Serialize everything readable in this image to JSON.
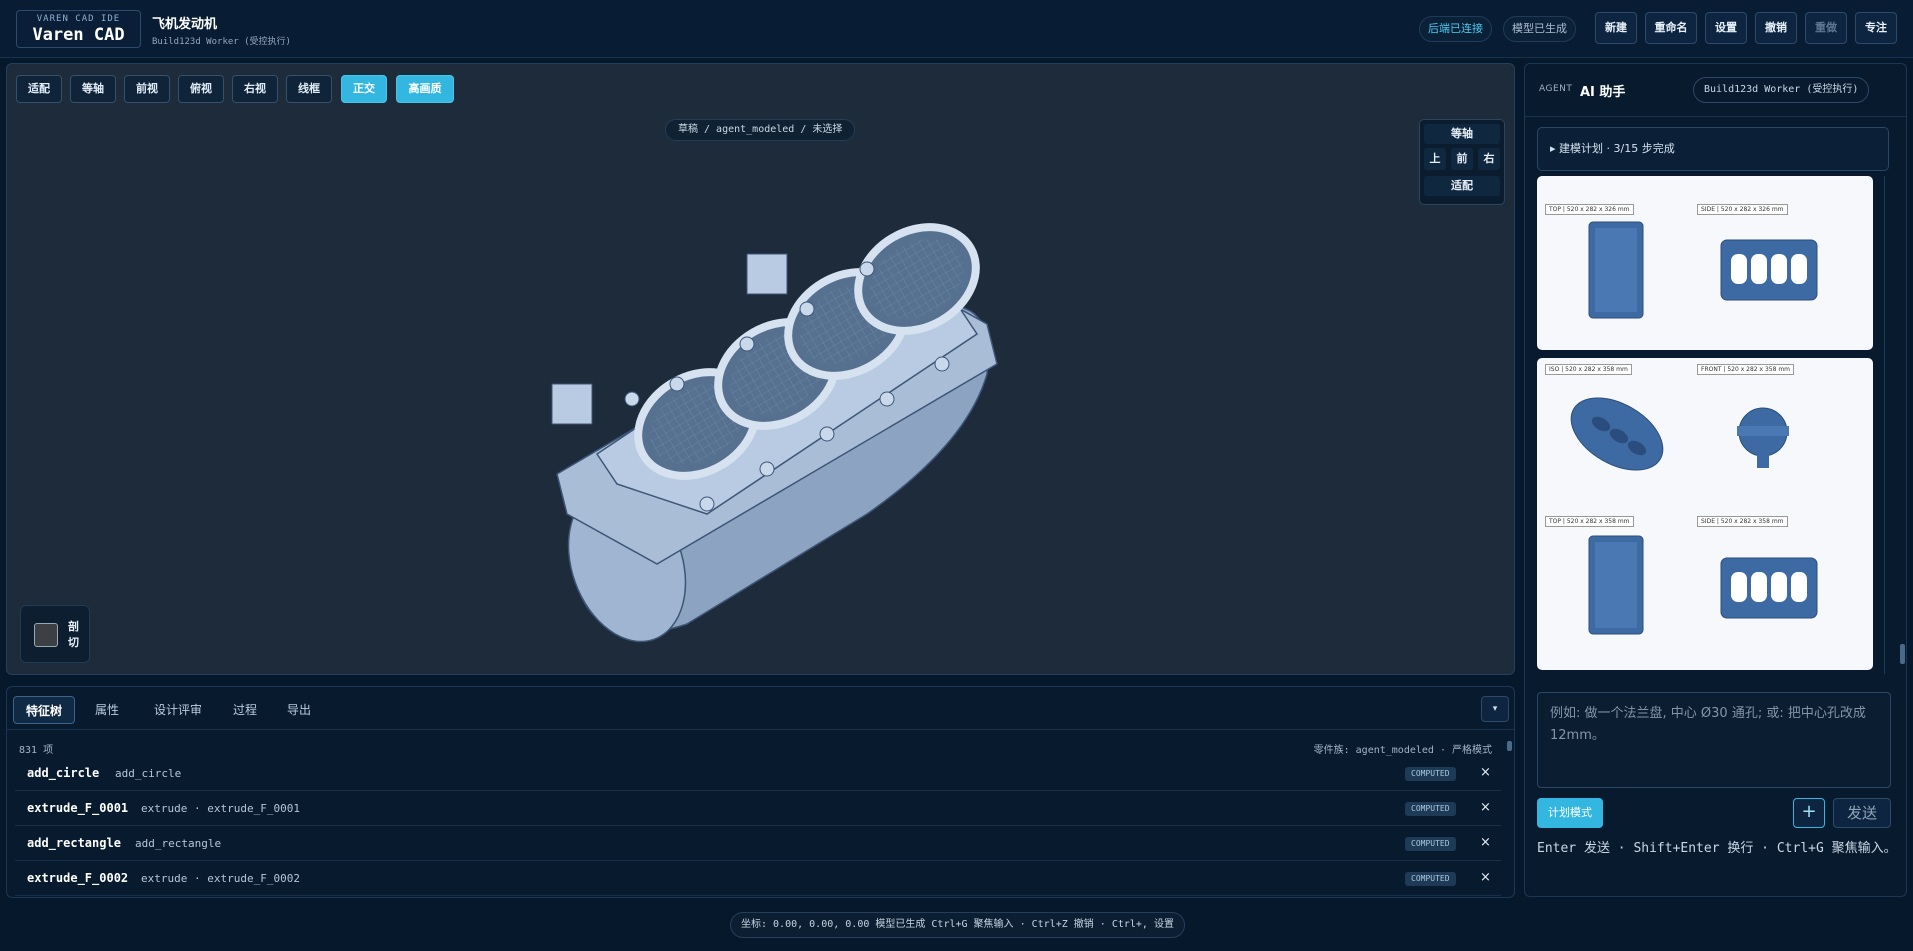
{
  "header": {
    "logo_small": "VAREN CAD IDE",
    "logo_big": "Varen CAD",
    "project_title": "飞机发动机",
    "project_sub": "Build123d Worker (受控执行)",
    "status_backend": "后端已连接",
    "status_model": "模型已生成",
    "buttons": {
      "new": "新建",
      "rename": "重命名",
      "settings": "设置",
      "undo": "撤销",
      "redo": "重做",
      "focus": "专注"
    }
  },
  "viewport": {
    "toolbar": {
      "fit": "适配",
      "iso": "等轴",
      "front": "前视",
      "top": "俯视",
      "right": "右视",
      "wire": "线框",
      "ortho": "正交",
      "hq": "高画质"
    },
    "breadcrumb": "草稿 / agent_modeled / 未选择",
    "viewcube": {
      "iso": "等轴",
      "top": "上",
      "front": "前",
      "right": "右",
      "fit": "适配"
    },
    "section_label": "剖切"
  },
  "bottom": {
    "tabs": {
      "features": "特征树",
      "props": "属性",
      "review": "设计评审",
      "process": "过程",
      "export": "导出"
    },
    "collapse": "▾",
    "count": "831 项",
    "family": "零件族: agent_modeled · 严格模式",
    "features": [
      {
        "name": "add_circle",
        "desc": "add_circle",
        "status": "COMPUTED",
        "del": "×"
      },
      {
        "name": "extrude_F_0001",
        "desc": "extrude · extrude_F_0001",
        "status": "COMPUTED",
        "del": "×"
      },
      {
        "name": "add_rectangle",
        "desc": "add_rectangle",
        "status": "COMPUTED",
        "del": "×"
      },
      {
        "name": "extrude_F_0002",
        "desc": "extrude · extrude_F_0002",
        "status": "COMPUTED",
        "del": "×"
      }
    ]
  },
  "statusbar": "坐标: 0.00, 0.00, 0.00   模型已生成   Ctrl+G 聚焦输入 · Ctrl+Z 撤销 · Ctrl+, 设置",
  "agent": {
    "tag": "AGENT",
    "title": "AI 助手",
    "worker": "Build123d Worker (受控执行)",
    "plan": "▸ 建模计划 · 3/15 步完成",
    "card1": {
      "top_label": "TOP | 520 x 282 x 326 mm",
      "side_label": "SIDE | 520 x 282 x 326 mm"
    },
    "card2": {
      "iso_label": "ISO | 520 x 282 x 358 mm",
      "front_label": "FRONT | 520 x 282 x 358 mm",
      "top_label": "TOP | 520 x 282 x 358 mm",
      "side_label": "SIDE | 520 x 282 x 358 mm"
    },
    "placeholder": "例如: 做一个法兰盘, 中心 Ø30 通孔; 或: 把中心孔改成 12mm。",
    "plan_mode": "计划模式",
    "plus": "+",
    "send": "发送",
    "hint": "Enter 发送 · Shift+Enter 换行 · Ctrl+G 聚焦输入。"
  }
}
